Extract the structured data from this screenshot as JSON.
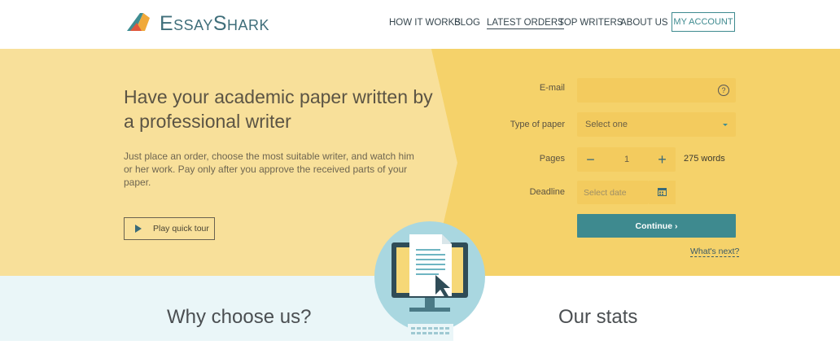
{
  "header": {
    "logo_text": "EssayShark",
    "nav": [
      "How it works",
      "Blog",
      "Latest orders",
      "Top writers",
      "About us"
    ],
    "active_nav": "Latest orders",
    "account_button": "My account"
  },
  "hero": {
    "title": "Have your academic paper written by a professional writer",
    "description": "Just place an order, choose the most suitable writer, and watch him or her work. Pay only after you approve the received parts of your paper.",
    "tour_button": "Play quick tour"
  },
  "form": {
    "email_label": "E-mail",
    "email_value": "",
    "help_icon": "?",
    "paper_label": "Type of paper",
    "paper_value": "Select one",
    "pages_label": "Pages",
    "pages_minus": "−",
    "pages_value": "1",
    "pages_plus": "+",
    "words_text": "275 words",
    "deadline_label": "Deadline",
    "deadline_placeholder": "Select date",
    "continue_button": "Continue ›",
    "whats_next": "What's next?"
  },
  "sections": {
    "why": "Why choose us?",
    "stats": "Our stats"
  },
  "colors": {
    "accent": "#3e8a8f",
    "hero_bg": "#f6d877",
    "field_bg": "#f3cb5e",
    "bottom_left_bg": "#eaf6f8"
  },
  "icons": [
    "shark-logo-icon",
    "help-icon",
    "play-icon",
    "calendar-icon",
    "caret-down-icon",
    "computer-illustration"
  ]
}
